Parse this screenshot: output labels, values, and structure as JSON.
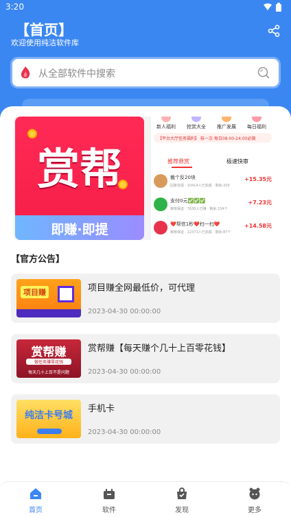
{
  "status_bar": {
    "time": "3:20"
  },
  "header": {
    "title": "【首页】",
    "subtitle": "欢迎使用纯洁软件库"
  },
  "search": {
    "placeholder": "从全部软件中搜索"
  },
  "banner": {
    "app_icon_text": "赏帮",
    "app_icon_bar_text": "即赚·即提",
    "quick_items": [
      "新人福利",
      "抢赏大全",
      "推广发展",
      "每日福利"
    ],
    "notice_text": "【平台大厅任务福利】 核一次·每日08:00-24:00必做",
    "tabs": [
      "推荐悬赏",
      "极速快审"
    ],
    "tasks": [
      {
        "name": "裁个反20块",
        "price": "+15.35元",
        "tags": "回复完成 · 10414人已完成 · 剩余:200"
      },
      {
        "name": "支付0元✅✅✅",
        "price": "+7.23元",
        "tags": "审核保证 · 7630人已赚 · 剩余:154个"
      },
      {
        "name": "❤️帮信1秒❤️扫一扫❤️",
        "price": "+14.58元",
        "tags": "审核保证 · 12371人已完成 · 剩余:87个"
      }
    ]
  },
  "section_title": "【官方公告】",
  "notices": [
    {
      "title": "项目赚全网最低价，可代理",
      "date": "2023-04-30 00:00:00",
      "thumb_text": "项目赚"
    },
    {
      "title": "赏帮赚【每天赚个几十上百零花钱】",
      "date": "2023-04-30 00:00:00",
      "thumb_text": "赏帮赚",
      "thumb_sub1": "做任务赚零花钱",
      "thumb_sub2": "每天几十上百不是问题"
    },
    {
      "title": "手机卡",
      "date": "2023-04-30 00:00:00",
      "thumb_text": "纯洁卡号城"
    }
  ],
  "tabbar": {
    "items": [
      {
        "label": "首页",
        "icon": "home-icon",
        "active": true
      },
      {
        "label": "软件",
        "icon": "software-icon",
        "active": false
      },
      {
        "label": "发现",
        "icon": "discover-icon",
        "active": false
      },
      {
        "label": "更多",
        "icon": "more-icon",
        "active": false
      }
    ]
  },
  "colors": {
    "primary": "#3b87f2",
    "card_bg": "#f1f1f1",
    "accent_red": "#e33333"
  }
}
